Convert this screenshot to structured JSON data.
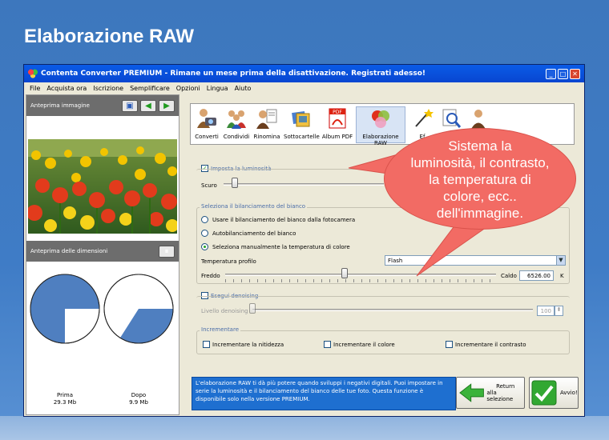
{
  "heading": "Elaborazione RAW",
  "window": {
    "title": "Contenta Converter PREMIUM  - Rimane un mese prima della disattivazione. Registrati adesso!",
    "min": "_",
    "max": "□",
    "close": "✕"
  },
  "menu": [
    "File",
    "Acquista ora",
    "Iscrizione",
    "Semplificare",
    "Opzioni",
    "Lingua",
    "Aiuto"
  ],
  "preview": {
    "title": "Anteprima immagine",
    "size_title": "Anteprima delle dimensioni"
  },
  "pies": {
    "before_label": "Prima",
    "before_size": "29.3 Mb",
    "before_fraction": 0.25,
    "after_label": "Dopo",
    "after_size": "9.9 Mb",
    "after_fraction": 0.34,
    "color": "#4f7fc0"
  },
  "toolbar": [
    {
      "label": "Converti",
      "icon": "person-camera-icon"
    },
    {
      "label": "Condividi",
      "icon": "people-icon"
    },
    {
      "label": "Rinomina",
      "icon": "person-document-icon"
    },
    {
      "label": "Sottocartelle",
      "icon": "folder-photos-icon"
    },
    {
      "label": "Album PDF",
      "icon": "pdf-icon"
    },
    {
      "label": "Elaborazione RAW",
      "icon": "color-balls-icon"
    },
    {
      "label": "Ef",
      "icon": "magic-wand-icon"
    },
    {
      "label": "",
      "icon": "magnifier-document-icon"
    },
    {
      "label": "",
      "icon": "person-icon"
    }
  ],
  "brightness": {
    "checkbox_label": "Imposta la luminosità",
    "low_label": "Scuro",
    "checked": true
  },
  "white_balance": {
    "title": "Seleziona il bilanciamento del bianco",
    "opt1": "Usare il bilanciamento del bianco dalla fotocamera",
    "opt2": "Autobilanciamento del bianco",
    "opt3": "Seleziona manualmente la temperatura di colore",
    "profile_label": "Temperatura profilo",
    "profile_value": "Flash",
    "cold_label": "Freddo",
    "warm_label": "Caldo",
    "temp_value": "6526.00",
    "unit": "K",
    "slider_fraction": 0.44
  },
  "denoise": {
    "checkbox_label": "Esegui denoising",
    "level_label": "Livello denoising",
    "level_value": "100"
  },
  "enhance": {
    "title": "Incrementare",
    "opt1": "Incrementare la nitidezza",
    "opt2": "Incrementare il colore",
    "opt3": "Incrementare il contrasto"
  },
  "info_text": "L'elaborazione RAW ti dà più potere quando sviluppi i negativi digitali. Puoi impostare in serie la luminosità e il bilanciamento del bianco delle tue foto. Questa funzione è disponibile solo nella versione PREMIUM.",
  "buttons": {
    "return_line1": "Return",
    "return_line2": "alla selezione",
    "start": "Avvio!"
  },
  "callout": [
    "Sistema la",
    "luminosità, il contrasto,",
    "la temperatura di",
    "colore, ecc..",
    "dell'immagine."
  ],
  "colors": {
    "callout": "#f26b64",
    "titlebar": "#0a5ce7",
    "info": "#1e6fd0"
  }
}
